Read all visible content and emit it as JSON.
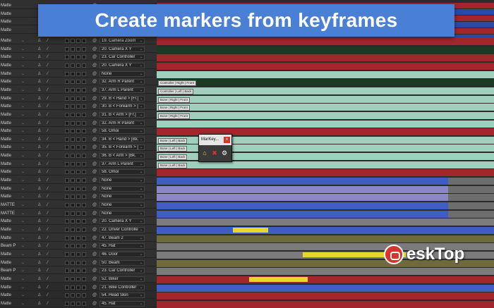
{
  "banner": {
    "title": "Create markers from keyframes"
  },
  "watermark": {
    "text": "esk",
    "text2": "Top"
  },
  "popup": {
    "title": "MarKey...",
    "close": "x",
    "icons": [
      "home-icon",
      "delete-icon",
      "gear-icon"
    ]
  },
  "colors": {
    "red": "#a2262c",
    "green": "#1b3a24",
    "teal": "#9fcfbd",
    "blue": "#3f5dc2",
    "lavender": "#8a86c8",
    "olive": "#6e6a3c",
    "gray": "#7b7b7b",
    "yellow": "#e8d62a",
    "banner": "#4a7fd6"
  },
  "layers": [
    {
      "mode": "Matte",
      "parent": "19. Camera Zoom"
    },
    {
      "mode": "Matte",
      "parent": "20. Camera X Y"
    },
    {
      "mode": "Matte",
      "parent": "23. Car Controller"
    },
    {
      "mode": "Matte",
      "parent": "20. Camera X Y"
    },
    {
      "mode": "Matte",
      "parent": "None"
    },
    {
      "mode": "Matte",
      "parent": "32. Arm R Parent"
    },
    {
      "mode": "Matte",
      "parent": "37. Arm L Parent"
    },
    {
      "mode": "Matte",
      "parent": "29. B < Hand > [Fr.]"
    },
    {
      "mode": "Matte",
      "parent": "30. B < Forearm > ["
    },
    {
      "mode": "Matte",
      "parent": "31. B < Arm > [Fr.]"
    },
    {
      "mode": "Matte",
      "parent": "32. Arm R Parent"
    },
    {
      "mode": "Matte",
      "parent": "58. Omoi"
    },
    {
      "mode": "Matte",
      "parent": "34. B < Hand > [Bk."
    },
    {
      "mode": "Matte",
      "parent": "35. B < Forearm > ["
    },
    {
      "mode": "Matte",
      "parent": "36. B < Arm > [Bk."
    },
    {
      "mode": "Matte",
      "parent": "37. Arm L Parent"
    },
    {
      "mode": "Matte",
      "parent": "58. Omoi"
    },
    {
      "mode": "Matte",
      "parent": "None"
    },
    {
      "mode": "Matte",
      "parent": "None"
    },
    {
      "mode": "Matte",
      "parent": "None"
    },
    {
      "mode": "MATTE",
      "parent": "None"
    },
    {
      "mode": "MATTE",
      "parent": "None"
    },
    {
      "mode": "Matte",
      "parent": "20. Camera X Y"
    },
    {
      "mode": "Matte",
      "parent": "22. Driver Controlle"
    },
    {
      "mode": "Matte",
      "parent": "47. Beam 2"
    },
    {
      "mode": "Beam P",
      "parent": "45. Hat"
    },
    {
      "mode": "Matte",
      "parent": "46. Door"
    },
    {
      "mode": "Matte",
      "parent": "50. Beam"
    },
    {
      "mode": "Beam P",
      "parent": "23. Car Controller"
    },
    {
      "mode": "Matte",
      "parent": "52. Biker"
    },
    {
      "mode": "Matte",
      "parent": "21. Bike Controller"
    },
    {
      "mode": "Matte",
      "parent": "54. Head Skin"
    },
    {
      "mode": "Matte",
      "parent": "45. Hat"
    }
  ],
  "markers": [
    "Controller | Right | Front",
    "Controller | Left | Back",
    "Bone | Right | Front",
    "Bone | Right | Front",
    "Bone | Right | Front",
    "Bone | Left | Back",
    "Bone | Left | Back",
    "Bone | Left | Back",
    "Bone | Left | Back"
  ]
}
